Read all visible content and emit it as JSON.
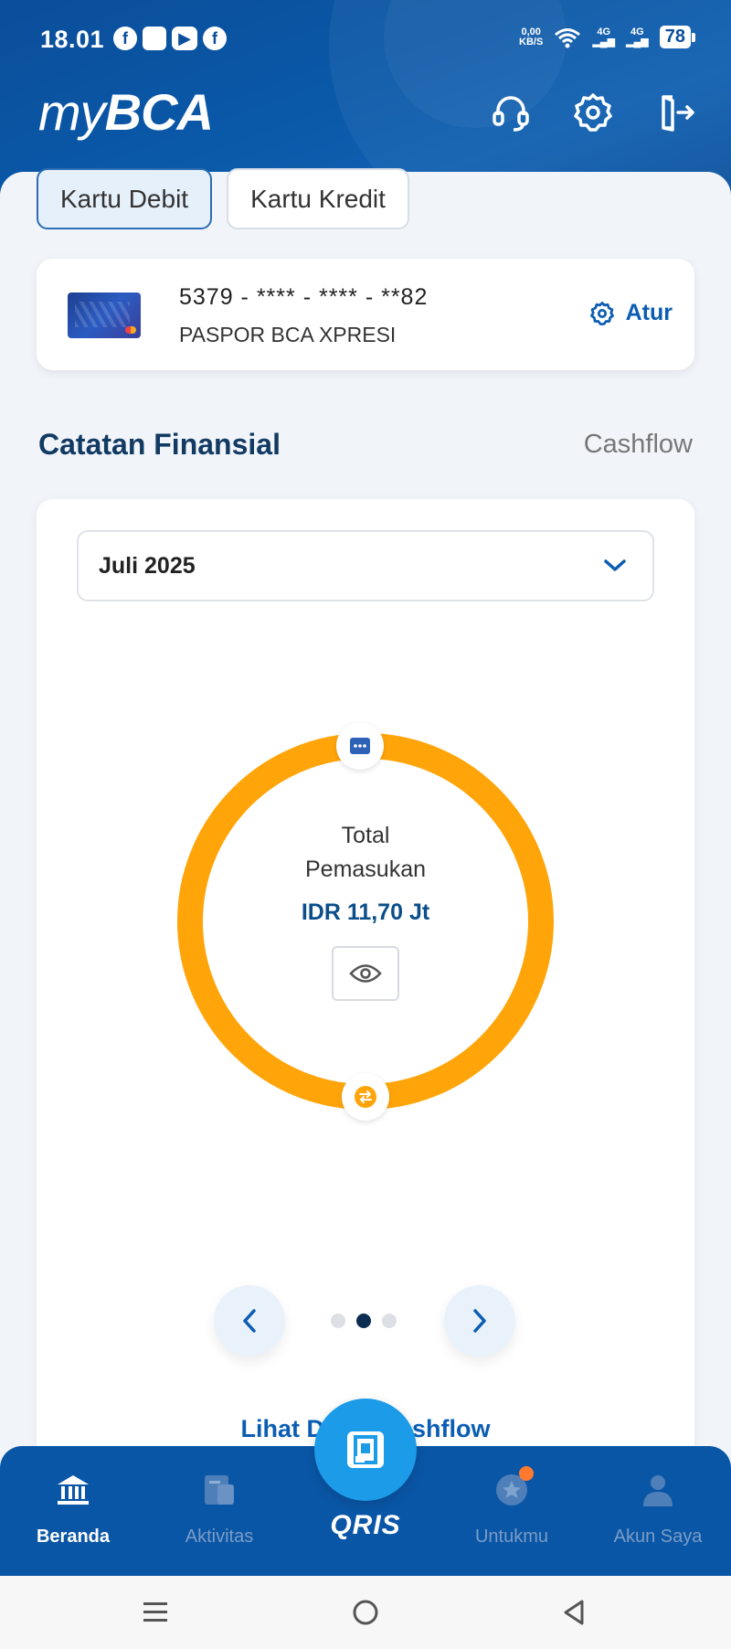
{
  "status_bar": {
    "time": "18.01",
    "net_speed_value": "0,00",
    "net_speed_unit": "KB/S",
    "signal1": "4G",
    "signal2": "4G",
    "battery": "78"
  },
  "header": {
    "logo_prefix": "my",
    "logo_main": "BCA",
    "icons": [
      "headset-icon",
      "gear-icon",
      "logout-icon"
    ]
  },
  "tabs": [
    {
      "label": "Kartu Debit",
      "active": true
    },
    {
      "label": "Kartu Kredit",
      "active": false
    }
  ],
  "card": {
    "number": "5379 - **** - **** - **82",
    "name": "PASPOR BCA XPRESI",
    "action_label": "Atur"
  },
  "section": {
    "title": "Catatan Finansial",
    "link": "Cashflow"
  },
  "finance": {
    "month": "Juli 2025",
    "center_title_line1": "Total",
    "center_title_line2": "Pemasukan",
    "amount": "IDR 11,70 Jt",
    "detail_link": "Lihat Detail Cashflow",
    "ring_color": "#FFA50A",
    "page_count": 3,
    "active_page": 2
  },
  "bottom_nav": {
    "items": [
      {
        "label": "Beranda",
        "active": true
      },
      {
        "label": "Aktivitas",
        "active": false
      },
      {
        "label": "QRIS",
        "active": false
      },
      {
        "label": "Untukmu",
        "active": false
      },
      {
        "label": "Akun Saya",
        "active": false
      }
    ]
  },
  "colors": {
    "brand_blue": "#0A56A6",
    "accent_orange": "#FFA50A",
    "link_blue": "#0B5DB3"
  }
}
